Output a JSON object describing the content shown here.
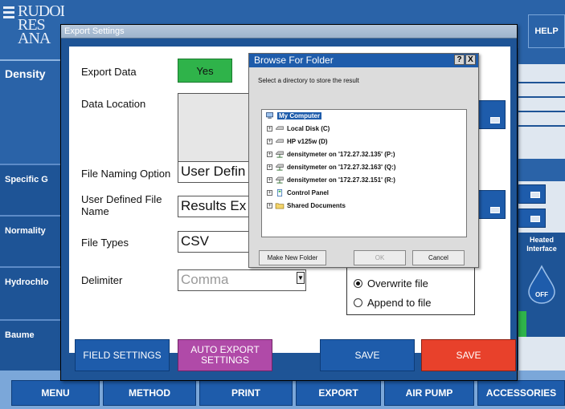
{
  "background_app": {
    "logo_lines": [
      "RUDOLPH",
      "RES",
      "ANA"
    ],
    "help_label": "HELP",
    "left_labels": [
      "Density",
      "Specific G",
      "Normality",
      "Hydrochlo",
      "Baume"
    ],
    "heated_interface": "Heated Interface",
    "off_label": "OFF",
    "bottom_nav": [
      "MENU",
      "METHOD",
      "PRINT",
      "EXPORT",
      "AIR PUMP",
      "ACCESSORIES"
    ]
  },
  "export_dialog": {
    "title": "Export Settings",
    "export_data_label": "Export Data",
    "export_data_value": "Yes",
    "data_location_label": "Data Location",
    "file_naming_label": "File Naming Option",
    "file_naming_value": "User Defin",
    "user_defined_label": "User Defined File Name",
    "user_defined_value": "Results Ex",
    "file_types_label": "File Types",
    "file_types_value": "CSV",
    "delimiter_label": "Delimiter",
    "delimiter_value": "Comma",
    "radio_overwrite": "Overwrite file",
    "radio_append": "Append to file",
    "buttons": {
      "field_settings": "FIELD SETTINGS",
      "auto_export": "AUTO EXPORT SETTINGS",
      "save_blue": "SAVE",
      "save_red": "SAVE"
    }
  },
  "browse_dialog": {
    "title": "Browse For Folder",
    "help_btn": "?",
    "close_btn": "X",
    "instruction": "Select a directory to store the result",
    "tree": [
      {
        "label": "My Computer",
        "icon": "computer-icon",
        "selected": true
      },
      {
        "label": "Local Disk (C)",
        "icon": "drive-icon"
      },
      {
        "label": "HP v125w (D)",
        "icon": "drive-icon"
      },
      {
        "label": "densitymeter on '172.27.32.135' (P:)",
        "icon": "network-drive-icon"
      },
      {
        "label": "densitymeter on '172.27.32.163' (Q:)",
        "icon": "network-drive-icon"
      },
      {
        "label": "densitymeter on '172.27.32.151' (R:)",
        "icon": "network-drive-icon"
      },
      {
        "label": "Control Panel",
        "icon": "control-panel-icon"
      },
      {
        "label": "Shared Documents",
        "icon": "folder-icon"
      }
    ],
    "new_folder_btn": "Make New Folder",
    "ok_btn": "OK",
    "cancel_btn": "Cancel"
  },
  "colors": {
    "app_blue": "#1e5496",
    "button_blue": "#1e5cab",
    "yes_green": "#2fb34a",
    "save_red": "#e8412b",
    "auto_export_purple": "#b04aa8"
  }
}
